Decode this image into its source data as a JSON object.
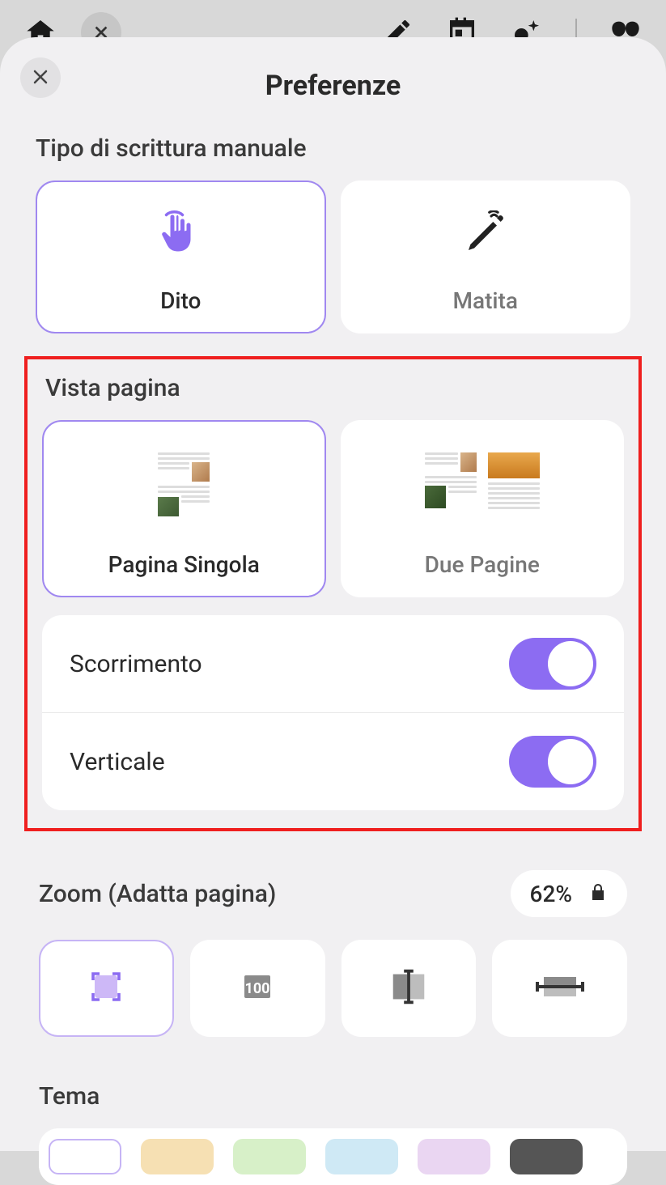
{
  "header": {
    "title": "Preferenze"
  },
  "handwriting": {
    "label": "Tipo di scrittura manuale",
    "options": [
      {
        "id": "finger",
        "label": "Dito",
        "selected": true
      },
      {
        "id": "pencil",
        "label": "Matita",
        "selected": false
      }
    ]
  },
  "page_view": {
    "label": "Vista pagina",
    "options": [
      {
        "id": "single",
        "label": "Pagina Singola",
        "selected": true
      },
      {
        "id": "double",
        "label": "Due Pagine",
        "selected": false
      }
    ],
    "toggles": [
      {
        "id": "scroll",
        "label": "Scorrimento",
        "on": true
      },
      {
        "id": "vertical",
        "label": "Verticale",
        "on": true
      }
    ]
  },
  "zoom": {
    "label": "Zoom (Adatta pagina)",
    "value": "62%",
    "locked": true,
    "modes": [
      {
        "id": "fit-page",
        "selected": true
      },
      {
        "id": "actual-100",
        "selected": false
      },
      {
        "id": "fit-width",
        "selected": false
      },
      {
        "id": "fit-height",
        "selected": false
      }
    ]
  },
  "theme": {
    "label": "Tema",
    "colors": [
      "#ffffff",
      "#f6e0b3",
      "#d7f0c8",
      "#cfe9f5",
      "#ead6f2",
      "#555555"
    ]
  }
}
